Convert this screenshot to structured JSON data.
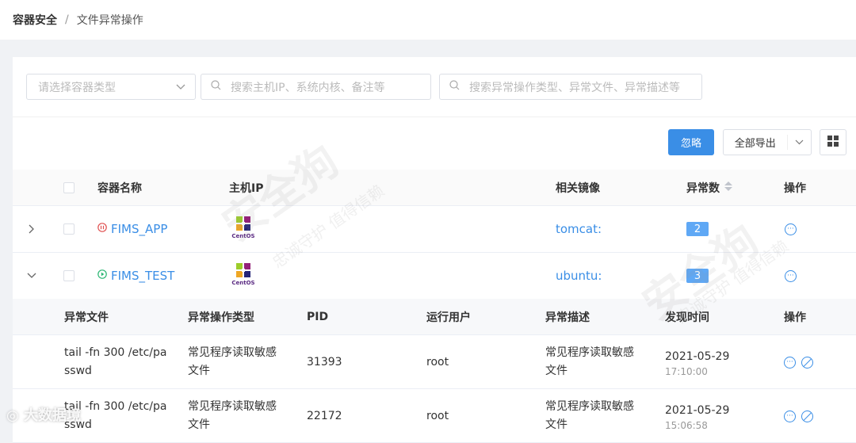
{
  "breadcrumb": {
    "root": "容器安全",
    "separator": "/",
    "current": "文件异常操作"
  },
  "filters": {
    "container_type_placeholder": "请选择容器类型",
    "host_search_placeholder": "搜索主机IP、系统内核、备注等",
    "anomaly_search_placeholder": "搜索异常操作类型、异常文件、异常描述等"
  },
  "toolbar": {
    "ignore_label": "忽略",
    "export_label": "全部导出"
  },
  "table": {
    "headers": {
      "name": "容器名称",
      "host_ip": "主机IP",
      "image": "相关镜像",
      "count": "异常数",
      "action": "操作"
    },
    "rows": [
      {
        "name": "FIMS_APP",
        "status": "paused",
        "os": "CentOS",
        "image": "tomcat:",
        "count": "2",
        "expanded": false
      },
      {
        "name": "FIMS_TEST",
        "status": "running",
        "os": "CentOS",
        "image": "ubuntu:",
        "count": "3",
        "expanded": true
      }
    ]
  },
  "sub_table": {
    "headers": {
      "file": "异常文件",
      "op_type": "异常操作类型",
      "pid": "PID",
      "user": "运行用户",
      "desc": "异常描述",
      "time": "发现时间",
      "action": "操作"
    },
    "rows": [
      {
        "file_line1": "tail -fn 300 /etc/pa",
        "file_line2": "sswd",
        "op_line1": "常见程序读取敏感",
        "op_line2": "文件",
        "pid": "31393",
        "user": "root",
        "desc_line1": "常见程序读取敏感",
        "desc_line2": "文件",
        "date": "2021-05-29",
        "time": "17:10:00"
      },
      {
        "file_line1": "tail -fn 300 /etc/pa",
        "file_line2": "sswd",
        "op_line1": "常见程序读取敏感",
        "op_line2": "文件",
        "pid": "22172",
        "user": "root",
        "desc_line1": "常见程序读取敏感",
        "desc_line2": "文件",
        "date": "2021-05-29",
        "time": "15:06:58"
      }
    ]
  },
  "watermarks": {
    "brand": "安全狗",
    "slogan": "忠诚守护  值得信赖",
    "corner": "大数据境"
  },
  "colors": {
    "accent": "#3a8ee6",
    "paused": "#e05050",
    "running": "#2bb673"
  }
}
